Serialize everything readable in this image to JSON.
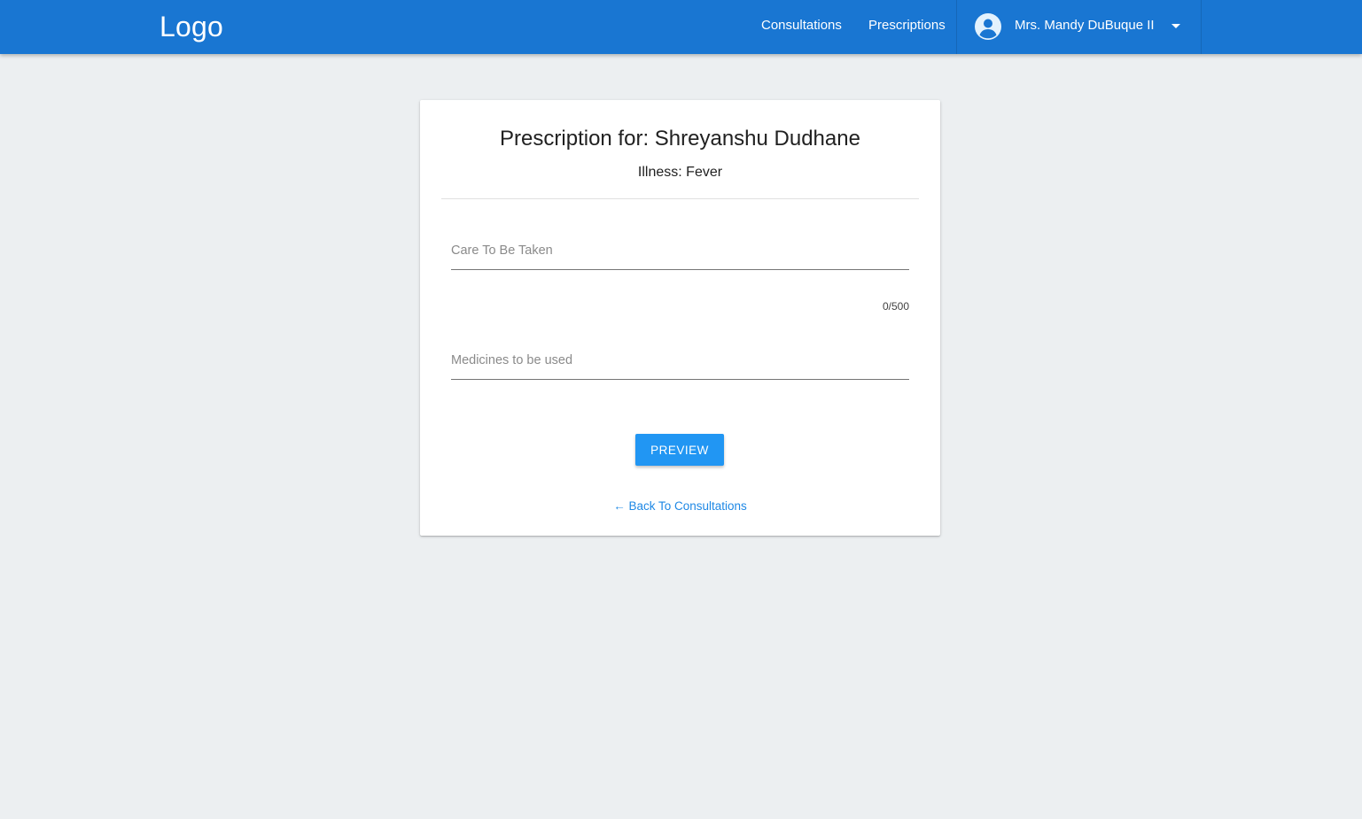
{
  "header": {
    "logo": "Logo",
    "nav": {
      "consultations": "Consultations",
      "prescriptions": "Prescriptions"
    },
    "user": {
      "name": "Mrs. Mandy DuBuque II",
      "avatar_icon": "account-circle-icon",
      "dropdown_icon": "caret-down-icon"
    }
  },
  "card": {
    "title": "Prescription for: Shreyanshu Dudhane",
    "subtitle": "Illness: Fever",
    "care_field": {
      "placeholder": "Care To Be Taken",
      "value": "",
      "counter": "0/500"
    },
    "medicines_field": {
      "placeholder": "Medicines to be used",
      "value": ""
    },
    "preview_button": "PREVIEW",
    "back_link": "← Back To Consultations"
  },
  "colors": {
    "primary": "#1976d2",
    "button": "#2196f3",
    "link": "#1e88e5",
    "background": "#eceff1"
  }
}
